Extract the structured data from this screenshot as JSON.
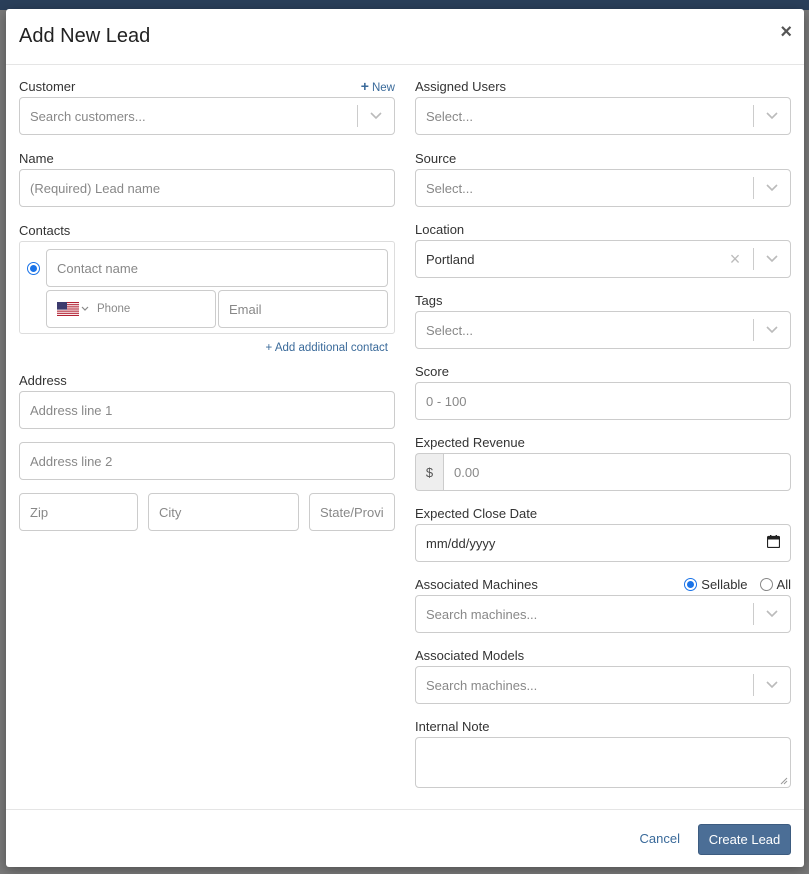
{
  "modal": {
    "title": "Add New Lead",
    "close_label": "×"
  },
  "left": {
    "customer": {
      "label": "Customer",
      "new_label": "New",
      "placeholder": "Search customers..."
    },
    "name": {
      "label": "Name",
      "placeholder": "(Required) Lead name"
    },
    "contacts": {
      "label": "Contacts",
      "contact_name_placeholder": "Contact name",
      "phone_placeholder": "Phone",
      "email_placeholder": "Email",
      "add_label": "+ Add additional contact"
    },
    "address": {
      "label": "Address",
      "line1_placeholder": "Address line 1",
      "line2_placeholder": "Address line 2",
      "zip_placeholder": "Zip",
      "city_placeholder": "City",
      "state_placeholder": "State/Provi"
    }
  },
  "right": {
    "assigned_users": {
      "label": "Assigned Users",
      "placeholder": "Select..."
    },
    "source": {
      "label": "Source",
      "placeholder": "Select..."
    },
    "location": {
      "label": "Location",
      "value": "Portland"
    },
    "tags": {
      "label": "Tags",
      "placeholder": "Select..."
    },
    "score": {
      "label": "Score",
      "placeholder": "0 - 100"
    },
    "expected_revenue": {
      "label": "Expected Revenue",
      "currency": "$",
      "placeholder": "0.00"
    },
    "close_date": {
      "label": "Expected Close Date",
      "placeholder": "mm/dd/yyyy"
    },
    "machines": {
      "label": "Associated Machines",
      "opt_sellable": "Sellable",
      "opt_all": "All",
      "selected": "Sellable",
      "placeholder": "Search machines..."
    },
    "models": {
      "label": "Associated Models",
      "placeholder": "Search machines..."
    },
    "note": {
      "label": "Internal Note"
    }
  },
  "footer": {
    "cancel_label": "Cancel",
    "submit_label": "Create Lead"
  },
  "colors": {
    "primary": "#4b6e96",
    "link": "#3a6a9a",
    "radio": "#1a73e8"
  }
}
